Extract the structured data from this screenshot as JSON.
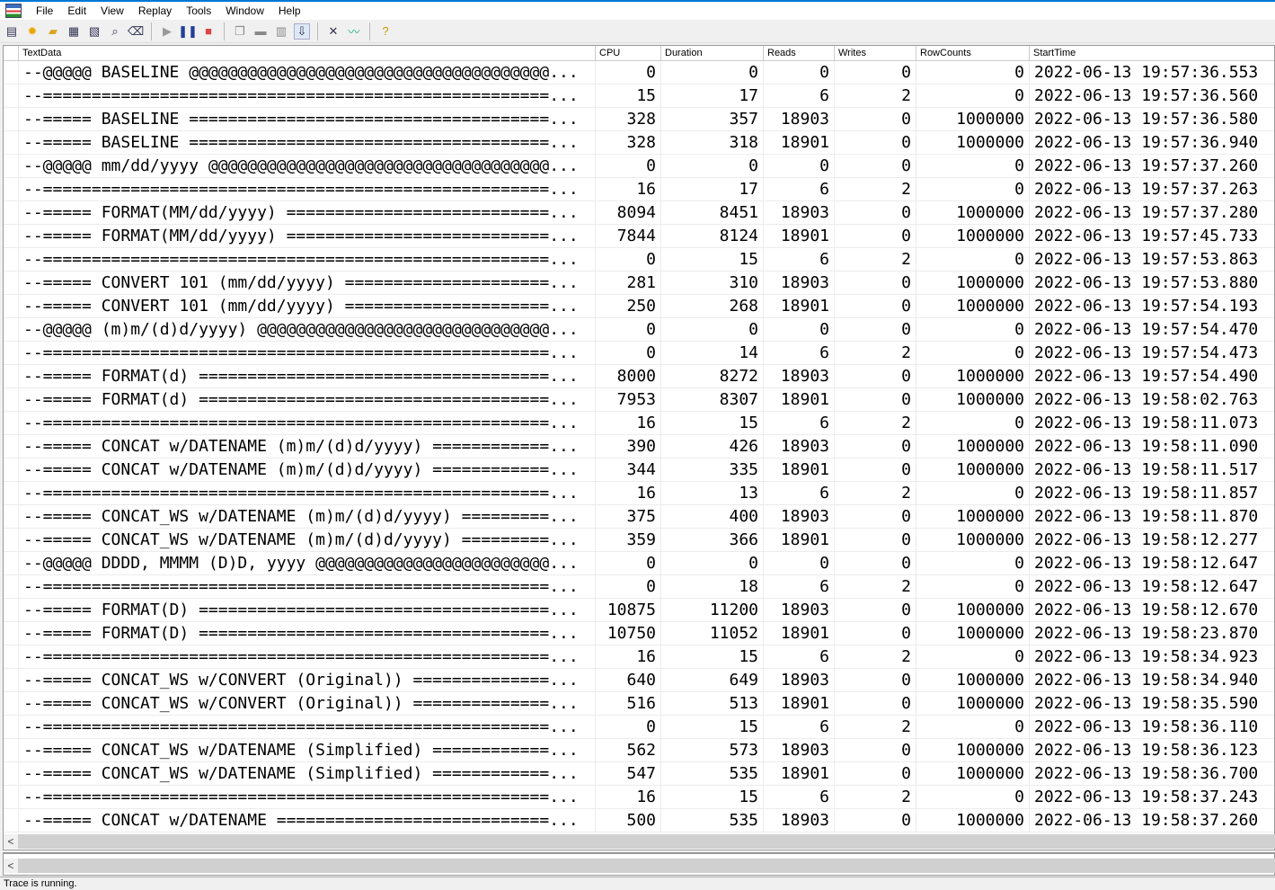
{
  "menu": [
    "File",
    "Edit",
    "View",
    "Replay",
    "Tools",
    "Window",
    "Help"
  ],
  "columns": [
    "TextData",
    "CPU",
    "Duration",
    "Reads",
    "Writes",
    "RowCounts",
    "StartTime"
  ],
  "rows": [
    [
      "--@@@@@ BASELINE @@@@@@@@@@@@@@@@@@@@@@@@@@@@@@@@@@@@@...",
      "0",
      "0",
      "0",
      "0",
      "0",
      "2022-06-13 19:57:36.553"
    ],
    [
      "--====================================================...",
      "15",
      "17",
      "6",
      "2",
      "0",
      "2022-06-13 19:57:36.560"
    ],
    [
      "--===== BASELINE =====================================...",
      "328",
      "357",
      "18903",
      "0",
      "1000000",
      "2022-06-13 19:57:36.580"
    ],
    [
      "--===== BASELINE =====================================...",
      "328",
      "318",
      "18901",
      "0",
      "1000000",
      "2022-06-13 19:57:36.940"
    ],
    [
      "--@@@@@ mm/dd/yyyy @@@@@@@@@@@@@@@@@@@@@@@@@@@@@@@@@@@...",
      "0",
      "0",
      "0",
      "0",
      "0",
      "2022-06-13 19:57:37.260"
    ],
    [
      "--====================================================...",
      "16",
      "17",
      "6",
      "2",
      "0",
      "2022-06-13 19:57:37.263"
    ],
    [
      "--===== FORMAT(MM/dd/yyyy) ===========================...",
      "8094",
      "8451",
      "18903",
      "0",
      "1000000",
      "2022-06-13 19:57:37.280"
    ],
    [
      "--===== FORMAT(MM/dd/yyyy) ===========================...",
      "7844",
      "8124",
      "18901",
      "0",
      "1000000",
      "2022-06-13 19:57:45.733"
    ],
    [
      "--====================================================...",
      "0",
      "15",
      "6",
      "2",
      "0",
      "2022-06-13 19:57:53.863"
    ],
    [
      "--===== CONVERT 101 (mm/dd/yyyy) =====================...",
      "281",
      "310",
      "18903",
      "0",
      "1000000",
      "2022-06-13 19:57:53.880"
    ],
    [
      "--===== CONVERT 101 (mm/dd/yyyy) =====================...",
      "250",
      "268",
      "18901",
      "0",
      "1000000",
      "2022-06-13 19:57:54.193"
    ],
    [
      "--@@@@@ (m)m/(d)d/yyyy) @@@@@@@@@@@@@@@@@@@@@@@@@@@@@@...",
      "0",
      "0",
      "0",
      "0",
      "0",
      "2022-06-13 19:57:54.470"
    ],
    [
      "--====================================================...",
      "0",
      "14",
      "6",
      "2",
      "0",
      "2022-06-13 19:57:54.473"
    ],
    [
      "--===== FORMAT(d) ====================================...",
      "8000",
      "8272",
      "18903",
      "0",
      "1000000",
      "2022-06-13 19:57:54.490"
    ],
    [
      "--===== FORMAT(d) ====================================...",
      "7953",
      "8307",
      "18901",
      "0",
      "1000000",
      "2022-06-13 19:58:02.763"
    ],
    [
      "--====================================================...",
      "16",
      "15",
      "6",
      "2",
      "0",
      "2022-06-13 19:58:11.073"
    ],
    [
      "--===== CONCAT w/DATENAME (m)m/(d)d/yyyy) ============...",
      "390",
      "426",
      "18903",
      "0",
      "1000000",
      "2022-06-13 19:58:11.090"
    ],
    [
      "--===== CONCAT w/DATENAME (m)m/(d)d/yyyy) ============...",
      "344",
      "335",
      "18901",
      "0",
      "1000000",
      "2022-06-13 19:58:11.517"
    ],
    [
      "--====================================================...",
      "16",
      "13",
      "6",
      "2",
      "0",
      "2022-06-13 19:58:11.857"
    ],
    [
      "--===== CONCAT_WS w/DATENAME (m)m/(d)d/yyyy) =========...",
      "375",
      "400",
      "18903",
      "0",
      "1000000",
      "2022-06-13 19:58:11.870"
    ],
    [
      "--===== CONCAT_WS w/DATENAME (m)m/(d)d/yyyy) =========...",
      "359",
      "366",
      "18901",
      "0",
      "1000000",
      "2022-06-13 19:58:12.277"
    ],
    [
      "--@@@@@ DDDD, MMMM (D)D, yyyy @@@@@@@@@@@@@@@@@@@@@@@@...",
      "0",
      "0",
      "0",
      "0",
      "0",
      "2022-06-13 19:58:12.647"
    ],
    [
      "--====================================================...",
      "0",
      "18",
      "6",
      "2",
      "0",
      "2022-06-13 19:58:12.647"
    ],
    [
      "--===== FORMAT(D) ====================================...",
      "10875",
      "11200",
      "18903",
      "0",
      "1000000",
      "2022-06-13 19:58:12.670"
    ],
    [
      "--===== FORMAT(D) ====================================...",
      "10750",
      "11052",
      "18901",
      "0",
      "1000000",
      "2022-06-13 19:58:23.870"
    ],
    [
      "--====================================================...",
      "16",
      "15",
      "6",
      "2",
      "0",
      "2022-06-13 19:58:34.923"
    ],
    [
      "--===== CONCAT_WS w/CONVERT (Original)) ==============...",
      "640",
      "649",
      "18903",
      "0",
      "1000000",
      "2022-06-13 19:58:34.940"
    ],
    [
      "--===== CONCAT_WS w/CONVERT (Original)) ==============...",
      "516",
      "513",
      "18901",
      "0",
      "1000000",
      "2022-06-13 19:58:35.590"
    ],
    [
      "--====================================================...",
      "0",
      "15",
      "6",
      "2",
      "0",
      "2022-06-13 19:58:36.110"
    ],
    [
      "--===== CONCAT_WS w/DATENAME (Simplified) ============...",
      "562",
      "573",
      "18903",
      "0",
      "1000000",
      "2022-06-13 19:58:36.123"
    ],
    [
      "--===== CONCAT_WS w/DATENAME (Simplified) ============...",
      "547",
      "535",
      "18901",
      "0",
      "1000000",
      "2022-06-13 19:58:36.700"
    ],
    [
      "--====================================================...",
      "16",
      "15",
      "6",
      "2",
      "0",
      "2022-06-13 19:58:37.243"
    ],
    [
      "--===== CONCAT w/DATENAME ============================...",
      "500",
      "535",
      "18903",
      "0",
      "1000000",
      "2022-06-13 19:58:37.260"
    ]
  ],
  "scroll_left": "<",
  "status": "Trace is running."
}
